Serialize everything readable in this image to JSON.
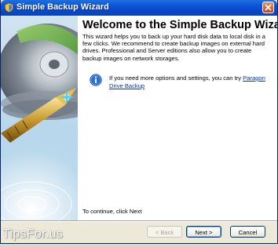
{
  "window": {
    "title": "Simple Backup Wizard"
  },
  "content": {
    "heading": "Welcome to the Simple Backup Wizard",
    "intro": "This wizard helps you to back up your hard disk data to local disk in a few clicks. We recommend to create backup images on external hard drives. Professional and Server editions also allow you to create backup images on network storages.",
    "info_text": "If you need more options and settings, you can try ",
    "info_link": "Paragon Drive Backup",
    "footer_note": "To continue, click Next"
  },
  "buttons": {
    "back": "< Back",
    "next": "Next >",
    "cancel": "Cancel"
  },
  "watermark": "TipsFor.us",
  "icons": {
    "title": "wizard-app-icon",
    "close": "close-icon",
    "info": "info-icon",
    "side_art": "disk-pen-illustration"
  },
  "colors": {
    "titlebar": "#0a52d6",
    "side_panel": "#bcd8ec",
    "link": "#0033cc",
    "info_icon": "#2a6fd6"
  }
}
